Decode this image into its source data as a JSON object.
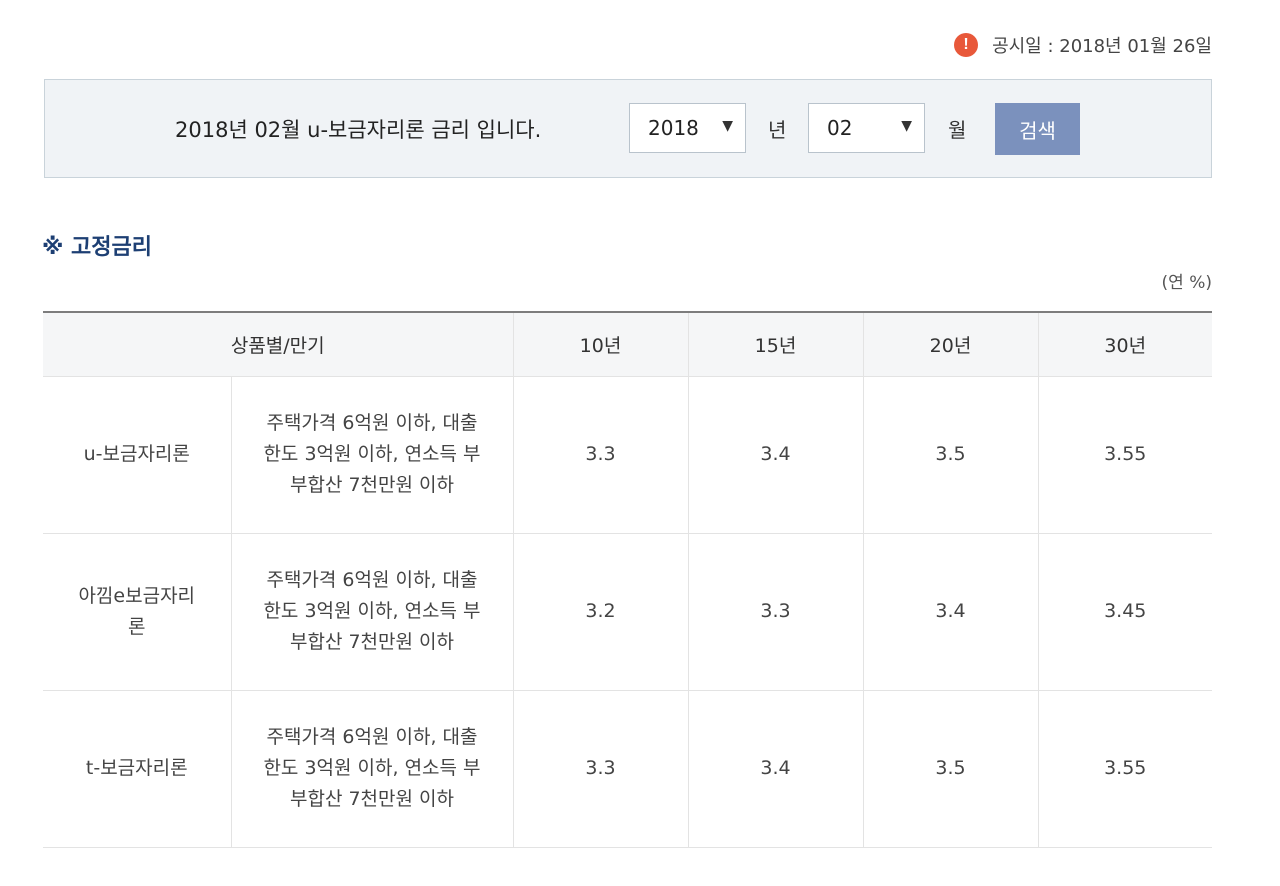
{
  "notice": {
    "icon": "exclamation-icon",
    "glyph": "!",
    "text": "공시일 : 2018년 01월 26일"
  },
  "search": {
    "title": "2018년 02월 u-보금자리론 금리 입니다.",
    "year_value": "2018",
    "year_unit": "년",
    "month_value": "02",
    "month_unit": "월",
    "arrow": "▼",
    "button_label": "검색",
    "button_color": "#7b91bd"
  },
  "section": {
    "title": "※ 고정금리",
    "unit": "(연 %)",
    "title_color": "#1d3f73"
  },
  "table": {
    "headers": [
      "상품별/만기",
      "10년",
      "15년",
      "20년",
      "30년"
    ],
    "rows": [
      {
        "product": "u-보금자리론",
        "condition": "주택가격 6억원 이하, 대출한도 3억원 이하, 연소득 부부합산 7천만원 이하",
        "rates": [
          "3.3",
          "3.4",
          "3.5",
          "3.55"
        ]
      },
      {
        "product": "아낌e보금자리론",
        "condition": "주택가격 6억원 이하, 대출한도 3억원 이하, 연소득 부부합산 7천만원 이하",
        "rates": [
          "3.2",
          "3.3",
          "3.4",
          "3.45"
        ]
      },
      {
        "product": "t-보금자리론",
        "condition": "주택가격 6억원 이하, 대출한도 3억원 이하, 연소득 부부합산 7천만원 이하",
        "rates": [
          "3.3",
          "3.4",
          "3.5",
          "3.55"
        ]
      }
    ]
  }
}
